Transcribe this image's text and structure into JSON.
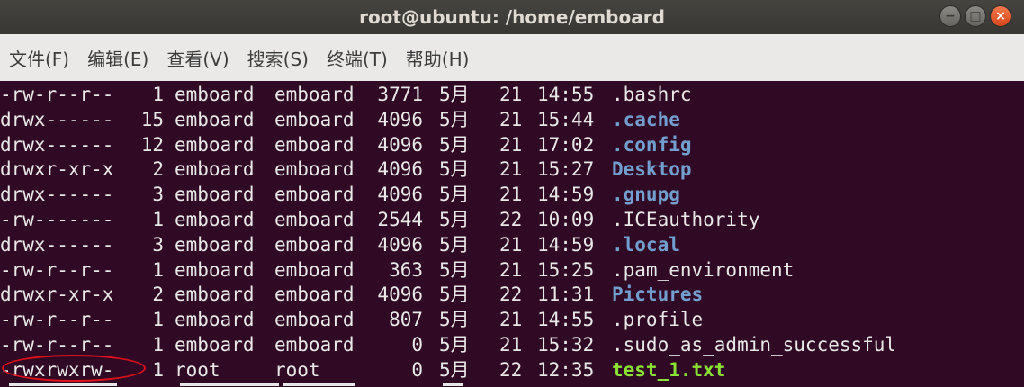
{
  "window": {
    "title": "root@ubuntu: /home/emboard",
    "controls": {
      "minimize": "−",
      "maximize": "□",
      "close": "×"
    }
  },
  "menubar": {
    "items": [
      "文件(F)",
      "编辑(E)",
      "查看(V)",
      "搜索(S)",
      "终端(T)",
      "帮助(H)"
    ]
  },
  "colors": {
    "terminal_bg": "#300a24",
    "text": "#e8e8e8",
    "directory": "#729fcf",
    "executable": "#8ae234",
    "annotation": "#e0101a"
  },
  "listing": {
    "columns": [
      "permissions",
      "links",
      "owner",
      "group",
      "size",
      "month",
      "day",
      "time",
      "name"
    ],
    "rows": [
      {
        "permissions": "-rw-r--r--",
        "links": "1",
        "owner": "emboard",
        "group": "emboard",
        "size": "3771",
        "month": "5月",
        "day": "21",
        "time": "14:55",
        "name": ".bashrc",
        "type": "file"
      },
      {
        "permissions": "drwx------",
        "links": "15",
        "owner": "emboard",
        "group": "emboard",
        "size": "4096",
        "month": "5月",
        "day": "21",
        "time": "15:44",
        "name": ".cache",
        "type": "dir"
      },
      {
        "permissions": "drwx------",
        "links": "12",
        "owner": "emboard",
        "group": "emboard",
        "size": "4096",
        "month": "5月",
        "day": "21",
        "time": "17:02",
        "name": ".config",
        "type": "dir"
      },
      {
        "permissions": "drwxr-xr-x",
        "links": "2",
        "owner": "emboard",
        "group": "emboard",
        "size": "4096",
        "month": "5月",
        "day": "21",
        "time": "15:27",
        "name": "Desktop",
        "type": "dir"
      },
      {
        "permissions": "drwx------",
        "links": "3",
        "owner": "emboard",
        "group": "emboard",
        "size": "4096",
        "month": "5月",
        "day": "21",
        "time": "14:59",
        "name": ".gnupg",
        "type": "dir"
      },
      {
        "permissions": "-rw-------",
        "links": "1",
        "owner": "emboard",
        "group": "emboard",
        "size": "2544",
        "month": "5月",
        "day": "22",
        "time": "10:09",
        "name": ".ICEauthority",
        "type": "file"
      },
      {
        "permissions": "drwx------",
        "links": "3",
        "owner": "emboard",
        "group": "emboard",
        "size": "4096",
        "month": "5月",
        "day": "21",
        "time": "14:59",
        "name": ".local",
        "type": "dir"
      },
      {
        "permissions": "-rw-r--r--",
        "links": "1",
        "owner": "emboard",
        "group": "emboard",
        "size": "363",
        "month": "5月",
        "day": "21",
        "time": "15:25",
        "name": ".pam_environment",
        "type": "file"
      },
      {
        "permissions": "drwxr-xr-x",
        "links": "2",
        "owner": "emboard",
        "group": "emboard",
        "size": "4096",
        "month": "5月",
        "day": "22",
        "time": "11:31",
        "name": "Pictures",
        "type": "dir"
      },
      {
        "permissions": "-rw-r--r--",
        "links": "1",
        "owner": "emboard",
        "group": "emboard",
        "size": "807",
        "month": "5月",
        "day": "21",
        "time": "14:55",
        "name": ".profile",
        "type": "file"
      },
      {
        "permissions": "-rw-r--r--",
        "links": "1",
        "owner": "emboard",
        "group": "emboard",
        "size": "0",
        "month": "5月",
        "day": "21",
        "time": "15:32",
        "name": ".sudo_as_admin_successful",
        "type": "file"
      },
      {
        "permissions": "-rwxrwxrw-",
        "links": "1",
        "owner": "root",
        "group": "root",
        "size": "0",
        "month": "5月",
        "day": "22",
        "time": "12:35",
        "name": "test_1.txt",
        "type": "exec",
        "annotated": true
      }
    ]
  }
}
